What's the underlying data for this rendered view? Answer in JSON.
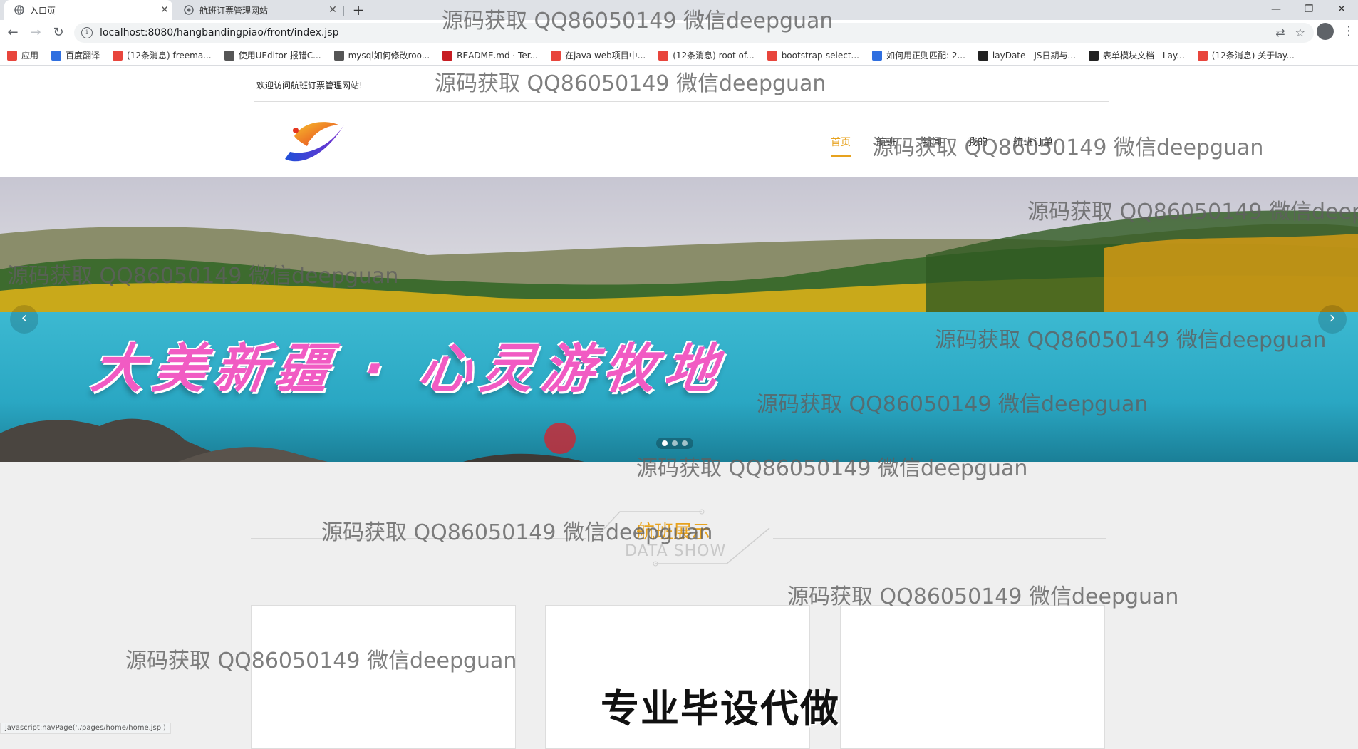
{
  "browser": {
    "tabs": [
      {
        "title": "入口页",
        "active": true
      },
      {
        "title": "航班订票管理网站",
        "active": false
      }
    ],
    "new_tab": "+",
    "url": "localhost:8080/hangbandingpiao/front/index.jsp",
    "bookmarks": [
      {
        "label": "应用",
        "icon": "apps-icon",
        "color": "#e8453c"
      },
      {
        "label": "百度翻译",
        "icon": "baidu-translate-icon",
        "color": "#2f6fe0"
      },
      {
        "label": "(12条消息) freema...",
        "icon": "csdn-icon",
        "color": "#e8453c"
      },
      {
        "label": "使用UEditor 报错C...",
        "icon": "link-icon",
        "color": "#555555"
      },
      {
        "label": "mysql如何修改roo...",
        "icon": "link-icon",
        "color": "#555555"
      },
      {
        "label": "README.md · Ter...",
        "icon": "gitee-icon",
        "color": "#c71d23"
      },
      {
        "label": "在java web项目中...",
        "icon": "csdn-icon",
        "color": "#e8453c"
      },
      {
        "label": "(12条消息) root of...",
        "icon": "csdn-icon",
        "color": "#e8453c"
      },
      {
        "label": "bootstrap-select...",
        "icon": "bootstrap-icon",
        "color": "#e8453c"
      },
      {
        "label": "如何用正则匹配: 2...",
        "icon": "baidu-icon",
        "color": "#2f6fe0"
      },
      {
        "label": "layDate - JS日期与...",
        "icon": "layui-icon",
        "color": "#222222"
      },
      {
        "label": "表单模块文档 - Lay...",
        "icon": "layui-icon",
        "color": "#222222"
      },
      {
        "label": "(12条消息) 关于lay...",
        "icon": "csdn-icon",
        "color": "#e8453c"
      }
    ]
  },
  "site": {
    "welcome": "欢迎访问航班订票管理网站!",
    "nav": [
      "首页",
      "航班",
      "新闻",
      "我的",
      "航班订单"
    ],
    "banner_text": "大美新疆 · 心灵游牧地",
    "section_cn": "航班展示",
    "section_en": "DATA SHOW",
    "promo": "专业毕设代做",
    "status": "javascript:navPage('./pages/home/home.jsp')"
  },
  "watermark": "源码获取 QQ86050149 微信deepguan",
  "colors": {
    "accent": "#e7a21e",
    "banner_text": "#f15bc3"
  }
}
